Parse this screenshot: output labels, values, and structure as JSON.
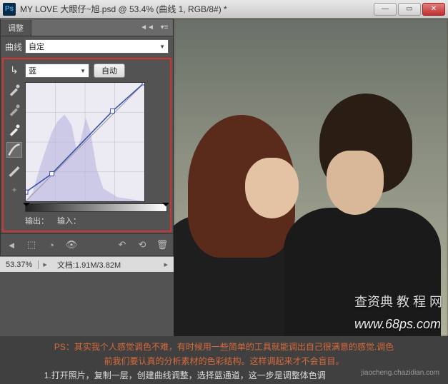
{
  "window": {
    "title": "MY LOVE   大眼仔~旭.psd @ 53.4% (曲线 1, RGB/8#) *",
    "ps_icon_text": "Ps"
  },
  "panel": {
    "tab": "调整",
    "curve_label": "曲线",
    "preset": "自定",
    "channel": "蓝",
    "auto_btn": "自动",
    "output_label": "输出：",
    "input_label": "输入："
  },
  "status": {
    "zoom": "53.37%",
    "doc_label": "文档:",
    "doc_size": "1.91M/3.82M"
  },
  "watermark": {
    "main": "www.68ps.com",
    "corner": "查资典 教 程 网",
    "corner2": "jiaocheng.chazidian.com"
  },
  "caption": {
    "line1": "PS：其实我个人感觉调色不难，有时候用一些简单的工具就能调出自己很满意的感觉.调色",
    "line2": "前我们要认真的分析素材的色彩结构。这样调起来才不会盲目。",
    "line3": "1.打开照片，复制一层，创建曲线调整，选择蓝通道，这一步是调整体色调"
  },
  "chart_data": {
    "type": "line",
    "title": "Curves - Blue Channel",
    "xlabel": "Input",
    "ylabel": "Output",
    "xlim": [
      0,
      255
    ],
    "ylim": [
      0,
      255
    ],
    "series": [
      {
        "name": "curve",
        "x": [
          0,
          56,
          187,
          255
        ],
        "y": [
          20,
          60,
          195,
          255
        ]
      }
    ],
    "histogram_present": true
  }
}
